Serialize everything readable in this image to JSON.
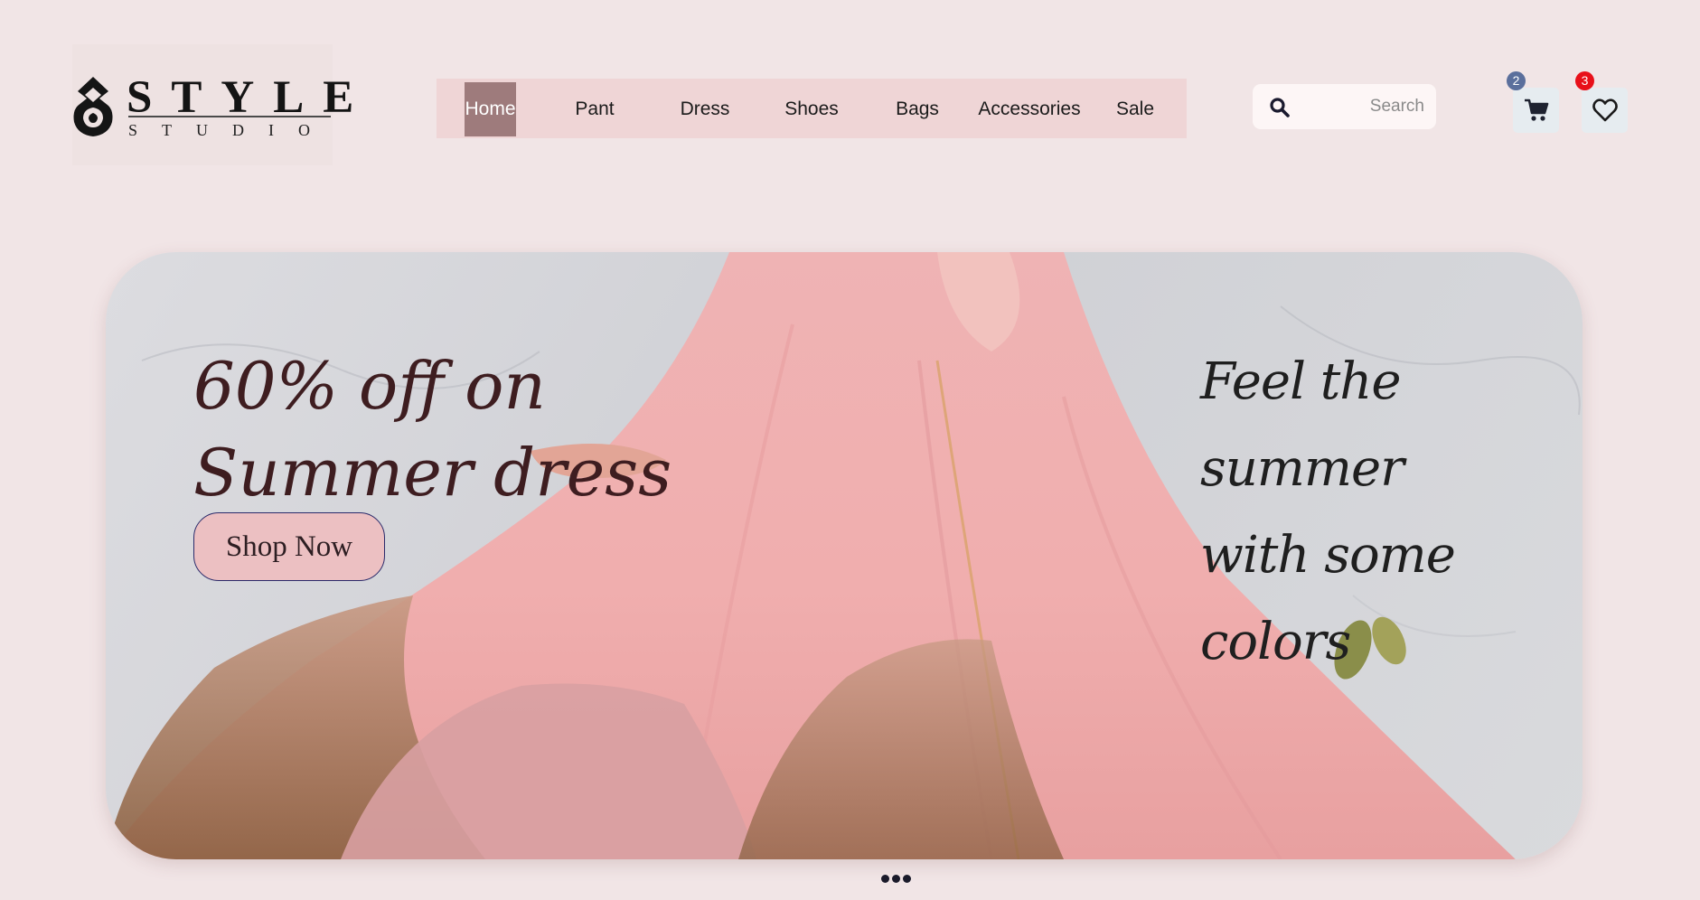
{
  "logo": {
    "word": "STYLE",
    "sub": "STUDIO"
  },
  "nav": {
    "items": [
      {
        "label": "Home",
        "active": true
      },
      {
        "label": "Pant"
      },
      {
        "label": "Dress"
      },
      {
        "label": "Shoes"
      },
      {
        "label": "Bags"
      },
      {
        "label": "Accessories"
      },
      {
        "label": "Sale"
      }
    ]
  },
  "search": {
    "placeholder": "Search",
    "value": "",
    "icon": "search-icon"
  },
  "cart": {
    "icon": "cart-icon",
    "count": "2",
    "badge_color": "#5b6f9c"
  },
  "wishlist": {
    "icon": "heart-icon",
    "count": "3",
    "badge_color": "#e8101a"
  },
  "hero": {
    "headline": "60% off on\nSummer dress",
    "cta": "Shop Now",
    "script": "Feel the summer\nwith some colors"
  },
  "carousel": {
    "dots": 3
  },
  "colors": {
    "background": "#f1e5e6",
    "nav_bg": "#efd5d6",
    "nav_active": "#9e7b7c",
    "cta_bg": "#ecc0c2",
    "headline": "#3e1d20"
  }
}
